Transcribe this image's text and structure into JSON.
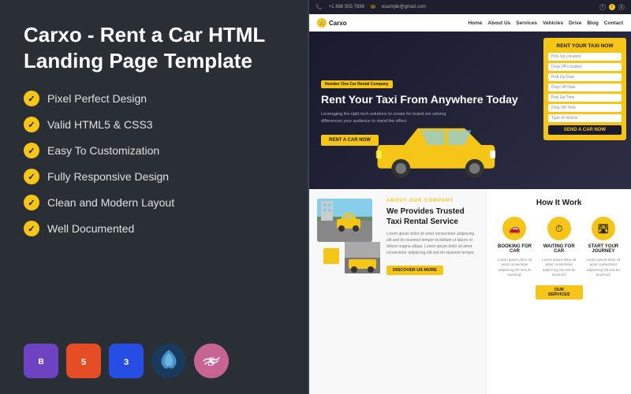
{
  "left": {
    "title": "Carxo - Rent a Car HTML Landing Page Template",
    "features": [
      "Pixel Perfect Design",
      "Valid HTML5 & CSS3",
      "Easy To Customization",
      "Fully Responsive Design",
      "Clean and Modern Layout",
      "Well Documented"
    ],
    "badges": [
      {
        "id": "bootstrap",
        "label": "B",
        "title": "Bootstrap"
      },
      {
        "id": "html5",
        "label": "5",
        "title": "HTML5"
      },
      {
        "id": "css3",
        "label": "3",
        "title": "CSS3"
      },
      {
        "id": "codeigniter",
        "label": "~",
        "title": "CodeIgniter"
      },
      {
        "id": "sass",
        "label": "S",
        "title": "Sass"
      }
    ]
  },
  "site_preview": {
    "topbar": {
      "phone": "+1 888 555 7898",
      "email": "example@gmail.com",
      "socials": [
        "f",
        "t",
        "g+"
      ]
    },
    "nav": {
      "logo": "Carxo",
      "links": [
        "Home",
        "About Us",
        "Services",
        "Vehicles",
        "Drive",
        "Blog",
        "Contact"
      ]
    },
    "hero": {
      "badge": "Number One Car Rental Company",
      "title": "Rent Your Taxi From Anywhere Today",
      "description": "Leveraging the right tech solutions to create for brand are solving differences your audience to stand the effect.",
      "cta": "RENT A CAR NOW",
      "form_title": "RENT YOUR TAXI NOW",
      "form_fields": [
        "Pick Up Location",
        "Drop Off Location",
        "Pick Up Date",
        "Drop Off Date",
        "Pick Up Time",
        "Drop Off Time",
        "Type of vehicle"
      ],
      "form_submit": "SEND A CAR NOW"
    },
    "about": {
      "badge": "ABOUT OUR COMPANY",
      "title": "We Provides Trusted Taxi Rental Service",
      "description": "Lorem ipsum dolor sit amet consectetur adipiscing elit sed do eiusmod tempor incididunt ut labore et dolore magna aliqua. Lorem ipsum dolor sit amet consectetur adipiscing elit sed do eiusmod tempor.",
      "cta": "DISCOVER US MORE"
    },
    "how": {
      "title": "How It Work",
      "steps": [
        {
          "icon": "🚗",
          "title": "BOOKING FOR CAR",
          "desc": "Lorem ipsum dolor sit amet consectetur adipiscing elit sed do eiusmod."
        },
        {
          "icon": "⏱",
          "title": "WAITING FOR CAR",
          "desc": "Lorem ipsum dolor sit amet consectetur adipiscing elit sed do eiusmod."
        },
        {
          "icon": "🛣",
          "title": "START YOUR JOURNEY",
          "desc": "Lorem ipsum dolor sit amet consectetur adipiscing elit sed do eiusmod."
        }
      ],
      "cta": "OUR SERVICES"
    }
  }
}
